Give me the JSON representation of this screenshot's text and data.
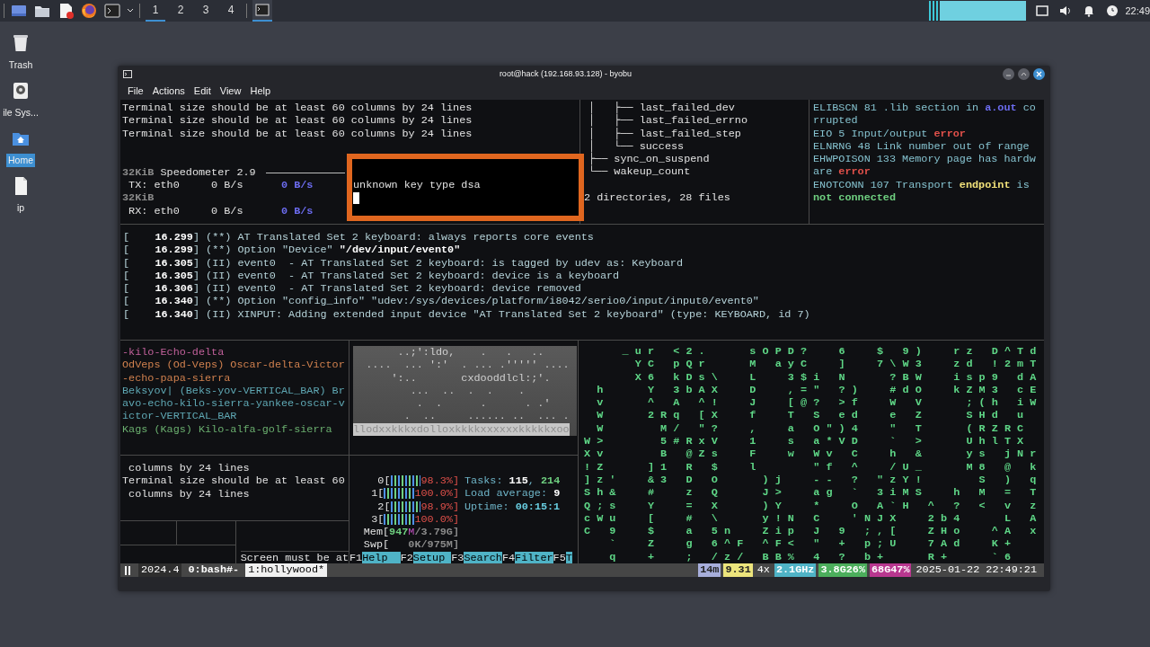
{
  "panel": {
    "workspaces": [
      {
        "label": "1",
        "selected": true
      },
      {
        "label": "2",
        "selected": false
      },
      {
        "label": "3",
        "selected": false
      },
      {
        "label": "4",
        "selected": false
      }
    ],
    "task": {
      "selected": true
    },
    "clock": "22:49"
  },
  "desktop_icons": [
    {
      "label": "Trash",
      "kind": "trash",
      "selected": false
    },
    {
      "label": "ile Sys...",
      "kind": "drive",
      "selected": false
    },
    {
      "label": "Home",
      "kind": "home",
      "selected": true
    },
    {
      "label": "ip",
      "kind": "file",
      "selected": false
    }
  ],
  "window": {
    "title": "root@hack (192.168.93.128) - byobu",
    "menu": [
      "File",
      "Actions",
      "Edit",
      "View",
      "Help"
    ]
  },
  "terminal": {
    "top_left": {
      "lines": [
        "Terminal size should be at least 60 columns by 24 lines",
        "Terminal size should be at least 60 columns by 24 lines",
        "Terminal size should be at least 60 columns by 24 lines"
      ]
    },
    "speedometer": {
      "title": [
        {
          "text": "32KiB",
          "kind": "dim"
        },
        {
          "text": " Speedometer 2.9 ",
          "kind": "plain"
        }
      ],
      "lines": [
        [
          {
            "text": " TX: eth0     0 B/s      ",
            "kind": "plain"
          },
          {
            "text": "0 B/s",
            "kind": "accent"
          }
        ],
        [
          {
            "text": "32KiB",
            "kind": "dim"
          }
        ],
        [
          {
            "text": " RX: eth0     0 B/s      ",
            "kind": "plain"
          },
          {
            "text": "0 B/s",
            "kind": "accent"
          }
        ]
      ]
    },
    "popup": {
      "text": "unknown key type dsa"
    },
    "tree": {
      "lines": [
        "│   ├── last_failed_dev",
        "│   ├── last_failed_errno",
        "│   ├── last_failed_step",
        "│   └── success",
        "├── sync_on_suspend",
        "└── wakeup_count"
      ],
      "summary": "2 directories, 28 files"
    },
    "errno": {
      "lines": [
        [
          {
            "text": "ELIBSCN 81 .lib section in ",
            "kind": "plain"
          },
          {
            "text": "a.out",
            "kind": "accent"
          },
          {
            "text": " co",
            "kind": "plain"
          }
        ],
        "rrupted",
        [
          {
            "text": "EIO 5 Input/output ",
            "kind": "plain"
          },
          {
            "text": "error",
            "kind": "error"
          }
        ],
        "ELNRNG 48 Link number out of range",
        "EHWPOISON 133 Memory page has hardw",
        [
          {
            "text": "are ",
            "kind": "plain"
          },
          {
            "text": "error",
            "kind": "error"
          }
        ],
        [
          {
            "text": "ENOTCONN 107 Transport ",
            "kind": "plain"
          },
          {
            "text": "endpoint",
            "kind": "warn"
          },
          {
            "text": " is",
            "kind": "plain"
          }
        ],
        [
          {
            "text": "not connected",
            "kind": "good"
          }
        ]
      ]
    },
    "log": {
      "lines": [
        [
          {
            "text": "[    ",
            "kind": "plain"
          },
          {
            "text": "16.299",
            "kind": "bold"
          },
          {
            "text": "] (**) AT Translated Set 2 keyboard: always reports core events",
            "kind": "plain"
          }
        ],
        [
          {
            "text": "[    ",
            "kind": "plain"
          },
          {
            "text": "16.299",
            "kind": "bold"
          },
          {
            "text": "] (**) Option \"Device\" ",
            "kind": "plain"
          },
          {
            "text": "\"/dev/input/event0\"",
            "kind": "bold"
          }
        ],
        [
          {
            "text": "[    ",
            "kind": "plain"
          },
          {
            "text": "16.305",
            "kind": "bold"
          },
          {
            "text": "] (II) event0  - AT Translated Set 2 keyboard: is tagged by udev as: Keyboard",
            "kind": "plain"
          }
        ],
        [
          {
            "text": "[    ",
            "kind": "plain"
          },
          {
            "text": "16.305",
            "kind": "bold"
          },
          {
            "text": "] (II) event0  - AT Translated Set 2 keyboard: device is a keyboard",
            "kind": "plain"
          }
        ],
        [
          {
            "text": "[    ",
            "kind": "plain"
          },
          {
            "text": "16.306",
            "kind": "bold"
          },
          {
            "text": "] (II) event0  - AT Translated Set 2 keyboard: device removed",
            "kind": "plain"
          }
        ],
        [
          {
            "text": "[    ",
            "kind": "plain"
          },
          {
            "text": "16.340",
            "kind": "bold"
          },
          {
            "text": "] (**) Option \"config_info\" \"udev:/sys/devices/platform/i8042/serio0/input/input0/event0\"",
            "kind": "plain"
          }
        ],
        [
          {
            "text": "[    ",
            "kind": "plain"
          },
          {
            "text": "16.340",
            "kind": "bold"
          },
          {
            "text": "] (II) XINPUT: Adding extended input device \"AT Translated Set 2 keyboard\" (type: KEYBOARD, id 7)",
            "kind": "plain"
          }
        ]
      ]
    },
    "callsigns": {
      "lines": [
        {
          "text": "-kilo-Echo-delta",
          "color": "#c0609a"
        },
        {
          "text": "OdVeps (Od-Veps) Oscar-delta-Victor",
          "color": "#d0804e"
        },
        {
          "text": "-echo-papa-sierra",
          "color": "#d0804e"
        },
        {
          "text": "Beksyov| (Beks-yov-VERTICAL_BAR) Br",
          "color": "#5fa8b4"
        },
        {
          "text": "avo-echo-kilo-sierra-yankee-oscar-v",
          "color": "#5fa8b4"
        },
        {
          "text": "ictor-VERTICAL_BAR",
          "color": "#5fa8b4"
        },
        {
          "text": "Kags (Kags) Kilo-alfa-golf-sierra",
          "color": "#6aae6e"
        }
      ]
    },
    "ascii_art": {
      "lines": [
        "       ..;':ldo,    .   .   ..    ",
        "  ....  ... ':'  . ... .''''' .... ",
        "      ':..       cxdooddlcl:;'.   ",
        "         ...  ..  .  .    .       ",
        "          .  .      .      . .'   ",
        "        .  ..     ...... ..  ... .",
        "llodxxkkkxdolloxkkkkxxxxxxkkkkkxoo"
      ]
    },
    "messages": {
      "lines": [
        " columns by 24 lines",
        "Terminal size should be at least 60",
        " columns by 24 lines"
      ],
      "note": "Screen must be at"
    },
    "htop": {
      "cpus": [
        {
          "label": "0[",
          "level": 0.983,
          "reading": "98.3%]"
        },
        {
          "label": "1[",
          "level": 1.0,
          "reading": "100.0%]"
        },
        {
          "label": "2[",
          "level": 0.989,
          "reading": "98.9%]"
        },
        {
          "label": "3[",
          "level": 1.0,
          "reading": "100.0%]"
        }
      ],
      "memory": [
        [
          {
            "text": "Mem[",
            "kind": "plain"
          },
          {
            "text": "947",
            "kind": "good"
          },
          {
            "text": "M",
            "kind": "magenta"
          },
          {
            "text": "/3.79G]",
            "kind": "dim"
          }
        ],
        [
          {
            "text": "Swp[",
            "kind": "plain"
          },
          {
            "text": "   0K/975M]",
            "kind": "dim"
          }
        ]
      ],
      "info": [
        [
          {
            "text": "Tasks: ",
            "kind": "plain"
          },
          {
            "text": "115",
            "kind": "bold"
          },
          {
            "text": ", ",
            "kind": "plain"
          },
          {
            "text": "214",
            "kind": "good"
          }
        ],
        [
          {
            "text": "Load average: ",
            "kind": "plain"
          },
          {
            "text": "9",
            "kind": "bold"
          }
        ],
        [
          {
            "text": "Uptime: ",
            "kind": "plain"
          },
          {
            "text": "00:15:1",
            "kind": "cyan"
          }
        ]
      ],
      "fkeys": [
        {
          "key": "F1",
          "label": "Help"
        },
        {
          "key": "F2",
          "label": "Setup"
        },
        {
          "key": "F3",
          "label": "Search"
        },
        {
          "key": "F4",
          "label": "Filter"
        },
        {
          "key": "F5",
          "label": "T"
        }
      ]
    },
    "matrix": {
      "lines": [
        "   _ur <2.   sOPD?  6  $ 9)  rz D^Td",
        "    YC pQr   M ayC  ]  7\\W3  zd !2mT",
        "    X6 kDs\\  L  3$i N   ?BW  isp9 dA",
        " h   Y 3bAX  D  ,=\" ?)  #dO  kZM3 cE",
        " v   ^ A ^!  J  [@? >f  W V   ;(h iW",
        " W   2Rq [X  f  T S ed  e Z   SHd u ",
        " W    M/ \"?  ,  a O\")4  \" T   (RZRC ",
        "W>    5#RxV  1  s a*VD  ` >   UhlTX ",
        "Xv    B @Zs  F  w Wv C  h &   ys jNr",
        "!Z   ]1 R $  l    \"f ^  /U_   M8 @ k",
        "]z'  &3 D O   )j  -- ? \"zY!    S ) q",
        "Sh&  #  z Q   J>  ag ` 3iMS  h M = T",
        "Q;s  Y  = X   )Y  *  O A`H ^ ? < v z",
        "cWu  [  # \\   y!N C  'NJX  2b4   L A",
        "C 9  $  a 5n  Zip J 9 ;,[  ZHo  ^A x",
        "  `  Z  g 6^F ^F< \" + p;U  7Ad  K+  ",
        "  q  +  ; /z/ BB% 4 ? b+   R+   `6  "
      ]
    },
    "status_bar": {
      "version": "2024.4",
      "windows": [
        {
          "label": "0:bash#-",
          "selected": false
        },
        {
          "label": "1:hollywood*",
          "selected": true
        }
      ],
      "indicators": [
        {
          "text": "14m",
          "color": "#a7aedb"
        },
        {
          "text": "9.31",
          "color": "#ece47c"
        },
        {
          "text": "4x"
        },
        {
          "text": "2.1GHz",
          "color": "#4fb3c6"
        },
        {
          "text": "3.8G26%",
          "color": "#4cae5c"
        },
        {
          "text": "68G47%",
          "color": "#b8378f"
        },
        {
          "text": "2025-01-22 22:49:21"
        }
      ]
    }
  }
}
